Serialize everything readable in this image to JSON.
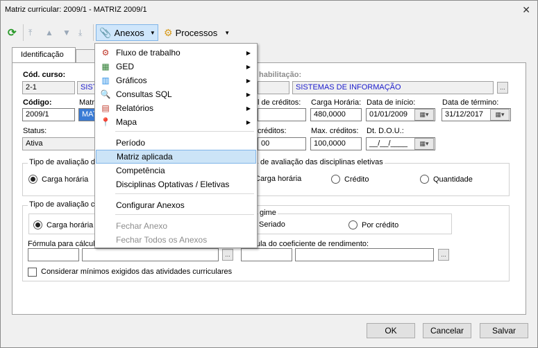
{
  "window": {
    "title": "Matriz curricular: 2009/1 - MATRIZ 2009/1"
  },
  "toolbar": {
    "anexos_label": "Anexos",
    "processos_label": "Processos"
  },
  "tabs": [
    {
      "label": "Identificação"
    }
  ],
  "form": {
    "cod_curso_label": "Cód. curso:",
    "cod_curso_value": "2-1",
    "curso_name_partial": "SIST",
    "habilitacao_label": "habilitação:",
    "habilitacao_value": "SISTEMAS DE INFORMAÇÃO",
    "codigo_label": "Código:",
    "codigo_value": "2009/1",
    "matriz_label": "Matriz",
    "matriz_value_partial": "MAT",
    "creditos_label": "l de créditos:",
    "carga_label": "Carga Horária:",
    "carga_value": "480,0000",
    "data_inicio_label": "Data de início:",
    "data_inicio_value": "01/01/2009",
    "data_termino_label": "Data de término:",
    "data_termino_value": "31/12/2017",
    "status_label": "Status:",
    "status_value": "Ativa",
    "min_creditos_label": "créditos:",
    "min_creditos_value": "00",
    "max_creditos_label": "Max. créditos:",
    "max_creditos_value": "100,0000",
    "dou_label": "Dt. D.O.U.:",
    "dou_value": "__/__/____"
  },
  "group1": {
    "title_left": "Tipo de avaliação da",
    "title_right": "de avaliação das disciplinas eletivas",
    "opt_carga_left": "Carga horária",
    "opt_carga_right": "Carga horária",
    "opt_credito": "Crédito",
    "opt_quantidade": "Quantidade"
  },
  "group2": {
    "title_left": "Tipo de avaliação c",
    "title_regime": "gime",
    "opt_carga": "Carga horária",
    "opt_seriado": "Seriado",
    "opt_por_credito": "Por crédito",
    "formula_label": "Fórmula para cálculo",
    "formula_coef_label": "ula do coeficiente de rendimento:",
    "checkbox_label": "Considerar mínimos exigidos das atividades curriculares"
  },
  "buttons": {
    "ok": "OK",
    "cancel": "Cancelar",
    "save": "Salvar",
    "ellipsis": "..."
  },
  "menu": {
    "items": [
      {
        "label": "Fluxo de trabalho"
      },
      {
        "label": "GED"
      },
      {
        "label": "Gráficos"
      },
      {
        "label": "Consultas SQL"
      },
      {
        "label": "Relatórios"
      },
      {
        "label": "Mapa"
      },
      {
        "label": "Período"
      },
      {
        "label": "Matriz aplicada"
      },
      {
        "label": "Competência"
      },
      {
        "label": "Disciplinas Optativas / Eletivas"
      },
      {
        "label": "Configurar Anexos"
      },
      {
        "label": "Fechar Anexo"
      },
      {
        "label": "Fechar Todos os Anexos"
      }
    ]
  }
}
